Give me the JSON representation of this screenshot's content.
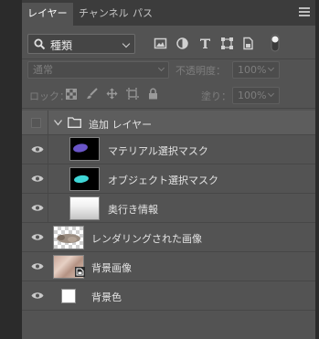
{
  "tabs": [
    {
      "label": "レイヤー",
      "active": true
    },
    {
      "label": "チャンネル",
      "active": false
    },
    {
      "label": "パス",
      "active": false
    }
  ],
  "filter": {
    "label": "種類",
    "icons": [
      "image-filter-icon",
      "adjustment-filter-icon",
      "type-filter-icon",
      "shape-filter-icon",
      "smart-object-filter-icon",
      "filter-toggle-icon"
    ]
  },
  "blend": {
    "mode": "通常",
    "opacity_label": "不透明度：",
    "opacity_value": "100%"
  },
  "lock": {
    "label": "ロック：",
    "fill_label": "塗り：",
    "fill_value": "100%",
    "icons": [
      "lock-transparent-icon",
      "lock-image-icon",
      "lock-position-icon",
      "lock-artboard-icon",
      "lock-all-icon"
    ]
  },
  "layers": [
    {
      "name": "追加 レイヤー",
      "type": "group",
      "visible": false,
      "expanded": true
    },
    {
      "name": "マテリアル選択マスク",
      "type": "child",
      "visible": true,
      "thumb": "mask-purple",
      "thumb_color": "#6a55c8"
    },
    {
      "name": "オブジェクト選択マスク",
      "type": "child",
      "visible": true,
      "thumb": "mask-cyan",
      "thumb_color": "#3fd6d6"
    },
    {
      "name": "奥行き情報",
      "type": "child",
      "visible": true,
      "thumb": "depth-gradient"
    },
    {
      "name": "レンダリングされた画像",
      "type": "layer",
      "visible": true,
      "thumb": "rendered-image"
    },
    {
      "name": "背景画像",
      "type": "layer",
      "visible": true,
      "thumb": "background-photo",
      "smart_object": true
    },
    {
      "name": "背景色",
      "type": "layer",
      "visible": true,
      "thumb": "white-fill"
    }
  ],
  "colors": {
    "panel_bg": "#535353",
    "tab_bar_bg": "#3c3c3c",
    "group_row_bg": "#5d5d5d",
    "text": "#e4e4e4",
    "disabled_text": "#7e7e7e"
  }
}
